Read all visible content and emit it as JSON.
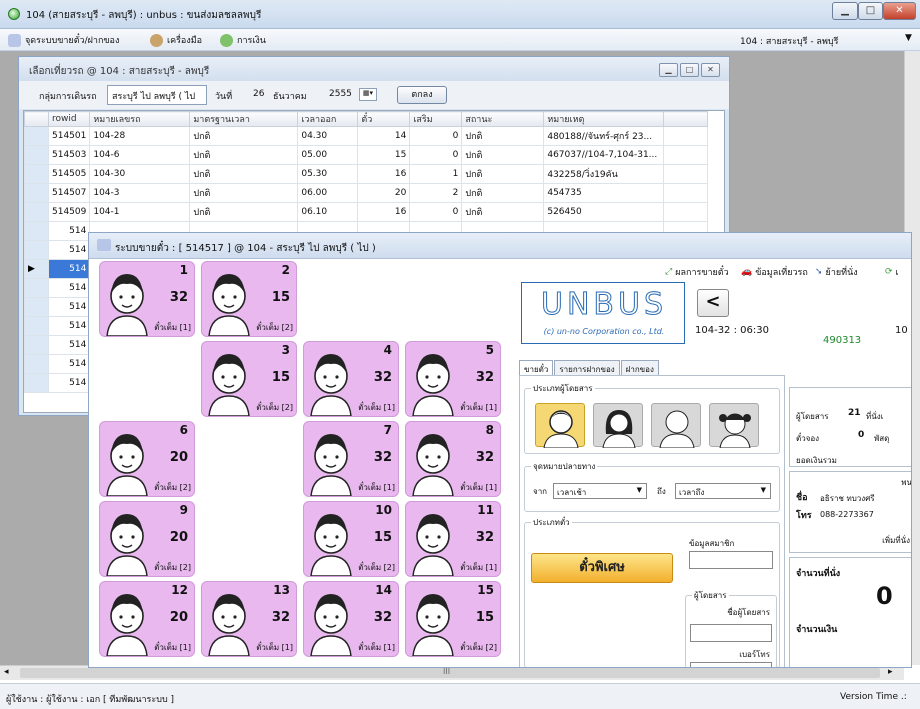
{
  "window": {
    "title": "104 (สายสระบุรี - ลพบุรี) : unbus : ขนส่งมลชลลพบุรี",
    "minimize": "▁",
    "maximize": "□",
    "close": "✕"
  },
  "menu": {
    "items": [
      "จุดระบบขายตั๋ว/ฝากของ",
      "เครื่องมือ",
      "การเงิน"
    ],
    "route": "104 : สายสระบุรี - ลพบุรี",
    "caret": "▼"
  },
  "trip_window": {
    "title": "เลือกเที่ยวรถ @ 104 : สายสระบุรี - ลพบุรี",
    "route_group_label": "กลุ่มการเดินรถ",
    "route_group_value": "สระบุรี ไป ลพบุรี ( ไป",
    "date_label": "วันที่",
    "day": "26",
    "month": "ธันวาคม",
    "year": "2555",
    "ok_button": "ตกลง",
    "columns": [
      "rowid",
      "หมายเลขรถ",
      "มาตรฐานเวลา",
      "เวลาออก",
      "ตั๋ว",
      "เสริม",
      "สถานะ",
      "หมายเหตุ"
    ],
    "rows": [
      [
        "514501",
        "104-28",
        "ปกติ",
        "04.30",
        "14",
        "0",
        "ปกติ",
        "480188//จันทร์-ศุกร์ 23..."
      ],
      [
        "514503",
        "104-6",
        "ปกติ",
        "05.00",
        "15",
        "0",
        "ปกติ",
        "467037//104-7,104-31..."
      ],
      [
        "514505",
        "104-30",
        "ปกติ",
        "05.30",
        "16",
        "1",
        "ปกติ",
        "432258/วิ่ง19คัน"
      ],
      [
        "514507",
        "104-3",
        "ปกติ",
        "06.00",
        "20",
        "2",
        "ปกติ",
        "454735"
      ],
      [
        "514509",
        "104-1",
        "ปกติ",
        "06.10",
        "16",
        "0",
        "ปกติ",
        "526450"
      ]
    ],
    "partial_rows": [
      "514",
      "514",
      "514",
      "514",
      "514",
      "514",
      "514",
      "514",
      "514"
    ]
  },
  "sales_window": {
    "title": "ระบบขายตั๋ว : [ 514517 ] @ 104 - สระบุรี ไป ลพบุรี ( ไป )",
    "seats": [
      {
        "no": "1",
        "count": "32",
        "type": "ตั๋วเต็ม [1]"
      },
      {
        "no": "2",
        "count": "15",
        "type": "ตั๋วเต็ม [2]"
      },
      {
        "no": "3",
        "count": "15",
        "type": "ตั๋วเต็ม [2]"
      },
      {
        "no": "4",
        "count": "32",
        "type": "ตั๋วเต็ม [1]"
      },
      {
        "no": "5",
        "count": "32",
        "type": "ตั๋วเต็ม [1]"
      },
      {
        "no": "6",
        "count": "20",
        "type": "ตั๋วเต็ม [2]"
      },
      {
        "no": "7",
        "count": "32",
        "type": "ตั๋วเต็ม [1]"
      },
      {
        "no": "8",
        "count": "32",
        "type": "ตั๋วเต็ม [1]"
      },
      {
        "no": "9",
        "count": "20",
        "type": "ตั๋วเต็ม [2]"
      },
      {
        "no": "10",
        "count": "15",
        "type": "ตั๋วเต็ม [2]"
      },
      {
        "no": "11",
        "count": "32",
        "type": "ตั๋วเต็ม [1]"
      },
      {
        "no": "12",
        "count": "20",
        "type": "ตั๋วเต็ม [1]"
      },
      {
        "no": "13",
        "count": "32",
        "type": "ตั๋วเต็ม [1]"
      },
      {
        "no": "14",
        "count": "32",
        "type": "ตั๋วเต็ม [1]"
      },
      {
        "no": "15",
        "count": "15",
        "type": "ตั๋วเต็ม [2]"
      }
    ],
    "toolbar": [
      "ผลการขายตั๋ว",
      "ข้อมูลเที่ยวรถ",
      "ย้ายที่นั่ง",
      "เ"
    ],
    "logo": "UNBUS",
    "logo_sub": "(c) un-no Corporation co., Ltd.",
    "back": "<",
    "trip_time": "104-32 : 06:30",
    "trip_code": "490313",
    "trip_right": "10",
    "tabs": [
      "ขายตั๋ว",
      "รายการฝากของ",
      "ฝากของ"
    ],
    "passenger_type_label": "ประเภทผู้โดยสาร",
    "destination_label": "จุดหมายปลายทาง",
    "from_label": "จาก",
    "from_value": "เวลาเช้า",
    "to_label": "ถึง",
    "to_value": "เวลาถึง",
    "ticket_type_label": "ประเภทตั๋ว",
    "member_label": "ข้อมูลสมาชิก",
    "special_button": "ตั๋วพิเศษ",
    "passenger_label": "ผู้โดยสาร",
    "passenger_name_label": "ชื่อผู้โดยสาร",
    "phone_label": "เบอร์โทร",
    "info": {
      "passengers_label": "ผู้โดยสาร",
      "passengers_value": "21",
      "seat_suffix": "ที่นั่งเ",
      "reserved_label": "ตั๋วจอง",
      "reserved_value": "0",
      "parcel_label": "พัสดุ",
      "total_label": "ยอดเงินรวม",
      "staff_header": "พน",
      "name_label": "ชื่อ",
      "name_value": "อธิราช ทบวงศรี",
      "phone_label": "โทร",
      "phone_value": "088-2273367",
      "add_seat": "เพิ่มที่นั่ง",
      "seat_count_label": "จำนวนที่นั่ง",
      "seat_count_value": "0",
      "money_label": "จำนวนเงิน"
    }
  },
  "status": {
    "user": "ผู้ใช้งาน : ผู้ใช้งาน : เอก [ ทีมพัฒนาระบบ ]",
    "version": "Version Time .:"
  },
  "hscroll_mark": "III"
}
